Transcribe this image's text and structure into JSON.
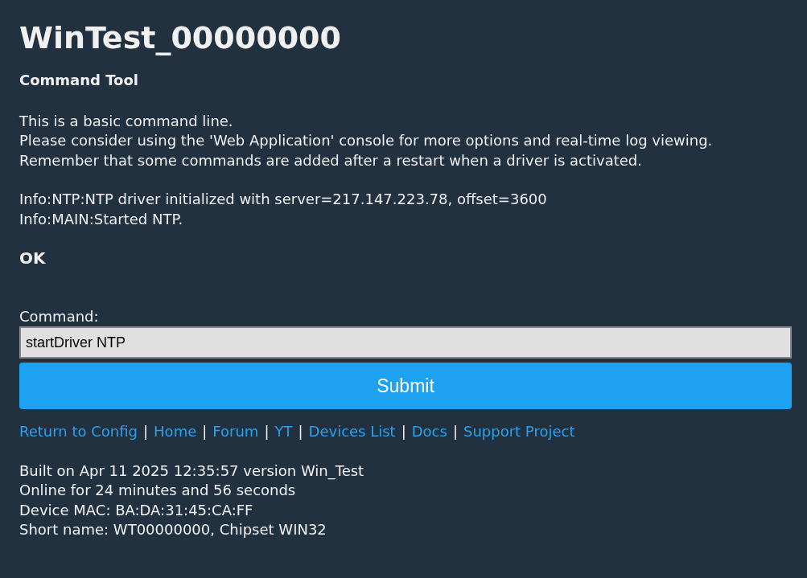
{
  "title": "WinTest_00000000",
  "subtitle": "Command Tool",
  "intro_lines": [
    "This is a basic command line.",
    "Please consider using the 'Web Application' console for more options and real-time log viewing.",
    "Remember that some commands are added after a restart when a driver is activated."
  ],
  "log_lines": [
    "Info:NTP:NTP driver initialized with server=217.147.223.78, offset=3600",
    "Info:MAIN:Started NTP."
  ],
  "result": "OK",
  "command": {
    "label": "Command:",
    "value": "startDriver NTP"
  },
  "submit": "Submit",
  "links": [
    {
      "label": "Return to Config"
    },
    {
      "label": "Home"
    },
    {
      "label": "Forum"
    },
    {
      "label": "YT"
    },
    {
      "label": "Devices List"
    },
    {
      "label": "Docs"
    },
    {
      "label": "Support Project"
    }
  ],
  "link_separator": "|",
  "info_lines": [
    "Built on Apr 11 2025 12:35:57 version Win_Test",
    "Online for 24 minutes and 56 seconds",
    "Device MAC: BA:DA:31:45:CA:FF",
    "Short name: WT00000000, Chipset WIN32"
  ]
}
